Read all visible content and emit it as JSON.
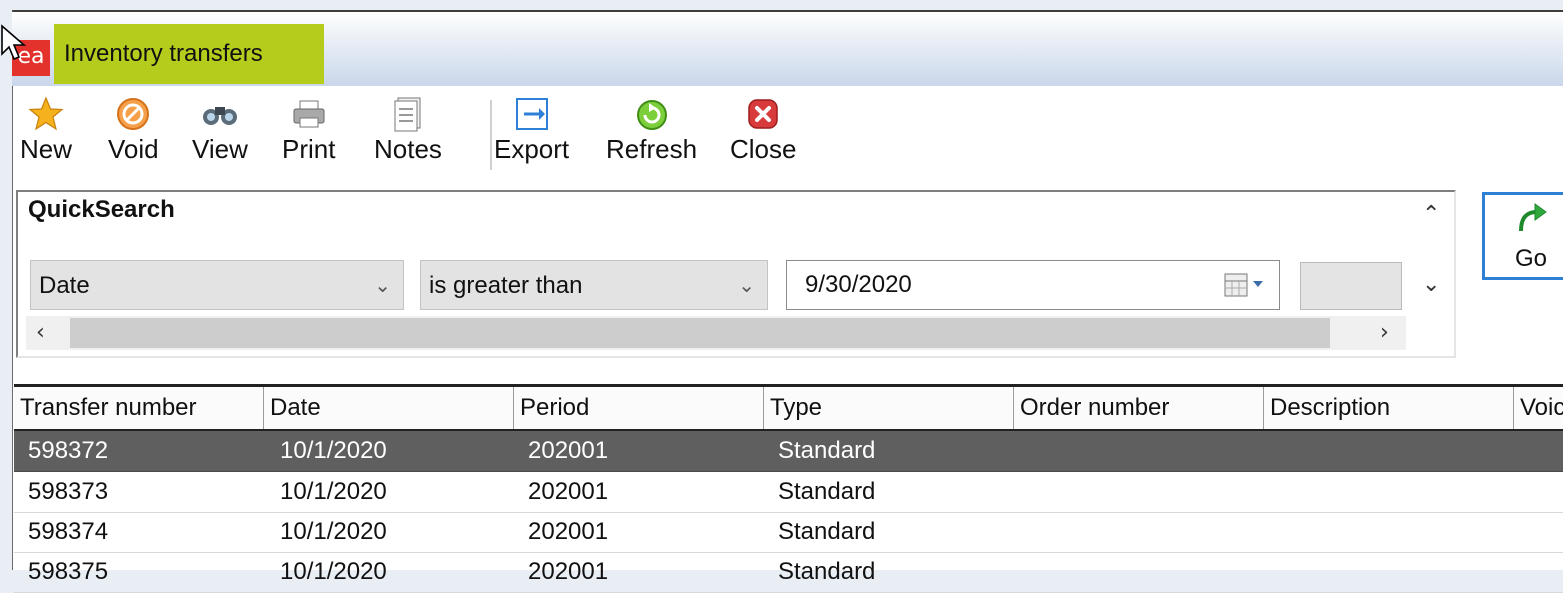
{
  "window": {
    "app_icon_text": "ea",
    "title": "Inventory transfers",
    "title_highlight_color": "#b5cc1c"
  },
  "toolbar": {
    "buttons": [
      {
        "label": "New",
        "icon": "star-icon"
      },
      {
        "label": "Void",
        "icon": "void-icon"
      },
      {
        "label": "View",
        "icon": "binoculars-icon"
      },
      {
        "label": "Print",
        "icon": "printer-icon"
      },
      {
        "label": "Notes",
        "icon": "notes-icon"
      },
      {
        "label": "Export",
        "icon": "export-icon"
      },
      {
        "label": "Refresh",
        "icon": "refresh-icon"
      },
      {
        "label": "Close",
        "icon": "close-icon"
      }
    ]
  },
  "quicksearch": {
    "title": "QuickSearch",
    "field": "Date",
    "operator": "is greater than",
    "value": "9/30/2020",
    "go_label": "Go"
  },
  "grid": {
    "columns": [
      "Transfer number",
      "Date",
      "Period",
      "Type",
      "Order number",
      "Description",
      "Voic"
    ],
    "rows": [
      {
        "transfer_number": "598372",
        "date": "10/1/2020",
        "period": "202001",
        "type": "Standard",
        "selected": true
      },
      {
        "transfer_number": "598373",
        "date": "10/1/2020",
        "period": "202001",
        "type": "Standard",
        "selected": false
      },
      {
        "transfer_number": "598374",
        "date": "10/1/2020",
        "period": "202001",
        "type": "Standard",
        "selected": false
      },
      {
        "transfer_number": "598375",
        "date": "10/1/2020",
        "period": "202001",
        "type": "Standard",
        "selected": false
      }
    ]
  }
}
